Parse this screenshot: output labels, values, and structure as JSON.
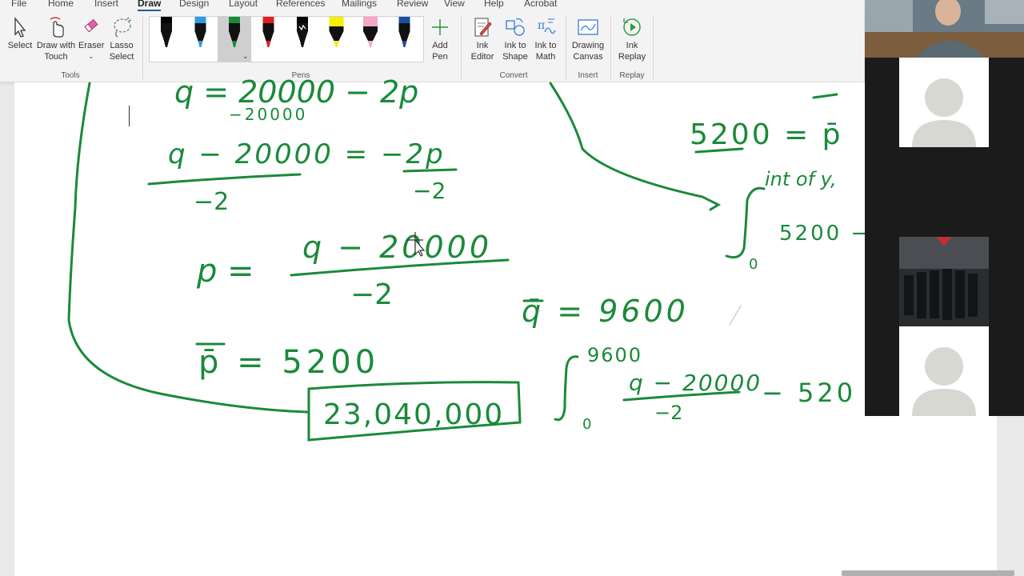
{
  "menu_tabs": [
    "File",
    "Home",
    "Insert",
    "Draw",
    "Design",
    "Layout",
    "References",
    "Mailings",
    "Review",
    "View",
    "Help",
    "Acrobat"
  ],
  "active_tab": "Draw",
  "ribbon": {
    "tools": {
      "select": "Select",
      "draw_with_touch_1": "Draw with",
      "draw_with_touch_2": "Touch",
      "eraser": "Eraser",
      "lasso_1": "Lasso",
      "lasso_2": "Select",
      "label": "Tools"
    },
    "pens": {
      "label": "Pens",
      "items": [
        {
          "name": "black-pen",
          "color": "#000000"
        },
        {
          "name": "blue-pen",
          "color": "#2e9be0"
        },
        {
          "name": "green-pen",
          "color": "#1a8a3a",
          "selected": true
        },
        {
          "name": "red-pen",
          "color": "#e02020"
        },
        {
          "name": "galaxy-pen",
          "color": "#000000"
        },
        {
          "name": "yellow-highlighter",
          "color": "#f5f000"
        },
        {
          "name": "pink-highlighter",
          "color": "#f7a6c8"
        },
        {
          "name": "navy-pen",
          "color": "#1d4fa0"
        }
      ],
      "add_pen_1": "Add",
      "add_pen_2": "Pen"
    },
    "convert": {
      "label": "Convert",
      "ink_editor_1": "Ink",
      "ink_editor_2": "Editor",
      "ink_to_shape_1": "Ink to",
      "ink_to_shape_2": "Shape",
      "ink_to_math_1": "Ink to",
      "ink_to_math_2": "Math"
    },
    "insert": {
      "label": "Insert",
      "drawing_canvas_1": "Drawing",
      "drawing_canvas_2": "Canvas"
    },
    "replay": {
      "label": "Replay",
      "ink_replay_1": "Ink",
      "ink_replay_2": "Replay"
    }
  },
  "ink_text": {
    "l1": "q = 20000 − 2p",
    "l1b": "−20000",
    "l2": "q − 20000 = −2p",
    "l2d": "−2",
    "l2d2": "−2",
    "l3": "p =",
    "l3n": "q − 20000",
    "l3d": "−2",
    "l4": "p̄ = 5200",
    "boxed": "23,040,000",
    "r1": "5200 = p̄",
    "int_upper": "int of y,",
    "int_lower": "0",
    "r2": "5200 −",
    "q_bar": "q̄ = 9600",
    "int2_upper": "9600",
    "int2_lower": "0",
    "int2_num": "q − 20000",
    "int2_den": "−2",
    "int2_tail": "− 520"
  },
  "colors": {
    "ink": "#1a8a3a",
    "accent": "#2b579a"
  }
}
